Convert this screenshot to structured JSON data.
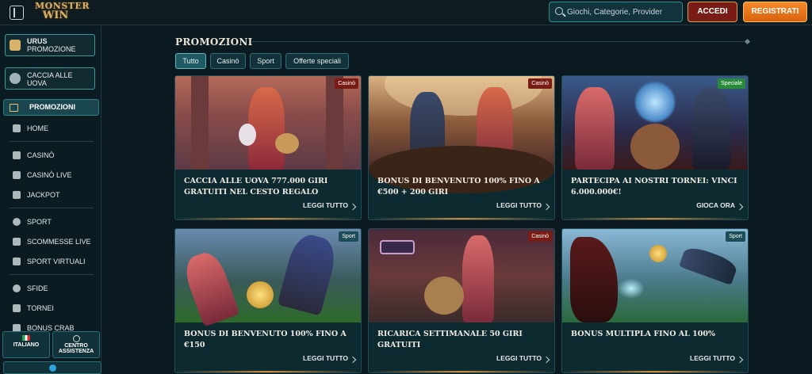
{
  "header": {
    "logo_top": "MONSTER",
    "logo_bottom": "WIN",
    "search_placeholder": "Giochi, Categorie, Provider",
    "login_label": "ACCEDI",
    "register_label": "REGISTRATI"
  },
  "sidebar": {
    "promo_cards": [
      {
        "title": "URUS",
        "subtitle": "PROMOZIONE"
      },
      {
        "title": "CACCIA ALLE UOVA"
      }
    ],
    "active_item": "PROMOZIONI",
    "items": [
      {
        "label": "HOME",
        "icon": "home-icon"
      },
      {
        "label": "CASINÒ",
        "icon": "casino-icon"
      },
      {
        "label": "CASINÒ LIVE",
        "icon": "live-casino-icon"
      },
      {
        "label": "JACKPOT",
        "icon": "jackpot-icon"
      },
      {
        "label": "SPORT",
        "icon": "sport-icon"
      },
      {
        "label": "SCOMMESSE LIVE",
        "icon": "live-bet-icon"
      },
      {
        "label": "SPORT VIRTUALI",
        "icon": "virtual-sport-icon"
      },
      {
        "label": "SFIDE",
        "icon": "challenge-icon"
      },
      {
        "label": "TORNEI",
        "icon": "trophy-icon"
      },
      {
        "label": "BONUS CRAB",
        "icon": "crab-icon"
      }
    ],
    "language_label": "ITALIANO",
    "support_label_1": "CENTRO",
    "support_label_2": "ASSISTENZA"
  },
  "main": {
    "title": "PROMOZIONI",
    "filters": [
      "Tutto",
      "Casinò",
      "Sport",
      "Offerte speciali"
    ],
    "cards": [
      {
        "badge": "Casinò",
        "badge_color": "#7a1c16",
        "title": "CACCIA ALLE UOVA 777.000 GIRI GRATUITI NEL CESTO REGALO",
        "cta": "LEGGI TUTTO"
      },
      {
        "badge": "Casinò",
        "badge_color": "#7a1c16",
        "title": "BONUS DI BENVENUTO 100% FINO A €500 + 200 GIRI",
        "cta": "LEGGI TUTTO"
      },
      {
        "badge": "Speciale",
        "badge_color": "#2a8a3c",
        "title": "PARTECIPA AI NOSTRI TORNEI: VINCI 6.000.000€!",
        "cta": "GIOCA ORA"
      },
      {
        "badge": "Sport",
        "badge_color": "#1d4d57",
        "title": "BONUS DI BENVENUTO 100% FINO A €150",
        "cta": "LEGGI TUTTO"
      },
      {
        "badge": "Casinò",
        "badge_color": "#7a1c16",
        "title": "RICARICA SETTIMANALE 50 GIRI GRATUITI",
        "cta": "LEGGI TUTTO"
      },
      {
        "badge": "Sport",
        "badge_color": "#1d4d57",
        "title": "BONUS MULTIPLA FINO AL 100%",
        "cta": "LEGGI TUTTO"
      }
    ]
  }
}
